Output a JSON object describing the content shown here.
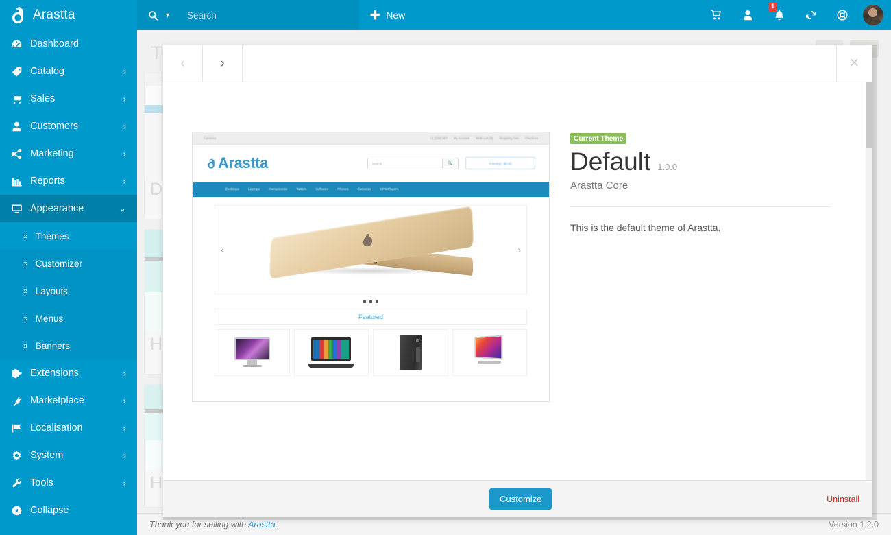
{
  "app": {
    "brand": "Arastta",
    "logo_icon": "arastta-a-logo-icon"
  },
  "topbar": {
    "search": {
      "placeholder": "Search",
      "value": "",
      "icon": "search-icon",
      "caret_icon": "caret-down-icon"
    },
    "new_button": {
      "label": "New",
      "icon": "plus-icon"
    },
    "icons": [
      {
        "name": "cart-icon",
        "badge": ""
      },
      {
        "name": "user-icon",
        "badge": ""
      },
      {
        "name": "bell-icon",
        "badge": "1"
      },
      {
        "name": "refresh-icon",
        "badge": ""
      },
      {
        "name": "lifebuoy-help-icon",
        "badge": ""
      }
    ],
    "avatar": "user-avatar"
  },
  "sidebar": {
    "items": [
      {
        "label": "Dashboard",
        "icon": "dashboard-gauge-icon",
        "has_caret": false,
        "active": false
      },
      {
        "label": "Catalog",
        "icon": "tag-icon",
        "has_caret": true,
        "active": false
      },
      {
        "label": "Sales",
        "icon": "cart-icon",
        "has_caret": true,
        "active": false
      },
      {
        "label": "Customers",
        "icon": "user-icon",
        "has_caret": true,
        "active": false
      },
      {
        "label": "Marketing",
        "icon": "share-nodes-icon",
        "has_caret": true,
        "active": false
      },
      {
        "label": "Reports",
        "icon": "bar-chart-icon",
        "has_caret": true,
        "active": false
      },
      {
        "label": "Appearance",
        "icon": "monitor-icon",
        "has_caret": true,
        "active": true
      }
    ],
    "appearance_submenu": [
      {
        "label": "Themes",
        "current": true
      },
      {
        "label": "Customizer",
        "current": false
      },
      {
        "label": "Layouts",
        "current": false
      },
      {
        "label": "Menus",
        "current": false
      },
      {
        "label": "Banners",
        "current": false
      }
    ],
    "items_after": [
      {
        "label": "Extensions",
        "icon": "puzzle-piece-icon",
        "has_caret": true
      },
      {
        "label": "Marketplace",
        "icon": "plug-icon",
        "has_caret": true
      },
      {
        "label": "Localisation",
        "icon": "flag-icon",
        "has_caret": true
      },
      {
        "label": "System",
        "icon": "gear-icon",
        "has_caret": true
      },
      {
        "label": "Tools",
        "icon": "wrench-icon",
        "has_caret": true
      }
    ],
    "collapse": {
      "label": "Collapse",
      "icon": "collapse-arrow-left-icon"
    }
  },
  "background_page": {
    "title": "Themes",
    "card_letters": [
      "D",
      "H",
      "H"
    ]
  },
  "modal": {
    "prev_icon": "chevron-left-icon",
    "next_icon": "chevron-right-icon",
    "close_icon": "close-x-icon",
    "theme": {
      "badge": "Current Theme",
      "name": "Default",
      "version": "1.0.0",
      "author": "Arastta Core",
      "description": "This is the default theme of Arastta."
    },
    "footer": {
      "customize_label": "Customize",
      "uninstall_label": "Uninstall"
    },
    "preview": {
      "top_links": [
        "+1 (234) 567",
        "My Account",
        "Wish List (0)",
        "Shopping Cart",
        "Checkout"
      ],
      "currency": "Currency",
      "logo": "Arastta",
      "search_placeholder": "Search",
      "search_icon": "search-icon",
      "cart_button": "0 item(s) - $0.00",
      "nav": [
        "Desktops",
        "Laptops",
        "Components",
        "Tablets",
        "Software",
        "Phones",
        "Cameras",
        "MP3 Players"
      ],
      "hero_prev_icon": "chevron-left-icon",
      "hero_next_icon": "chevron-right-icon",
      "hero_image": "gold-macbook-laptop",
      "featured_heading": "Featured",
      "products": [
        "apple-cinema-monitor",
        "windows-laptop",
        "desktop-tower-pc",
        "imac-all-in-one"
      ]
    }
  },
  "footer": {
    "thanks_prefix": "Thank you for selling with ",
    "thanks_link": "Arastta",
    "thanks_suffix": ".",
    "version": "Version 1.2.0"
  },
  "colors": {
    "sidebar": "#0099cc",
    "sidebar_active": "#007fa8",
    "submenu": "#0093c4",
    "accent": "#1b97c9",
    "badge_green": "#8bbd5a",
    "badge_red": "#e8453c",
    "danger": "#c9302c"
  }
}
